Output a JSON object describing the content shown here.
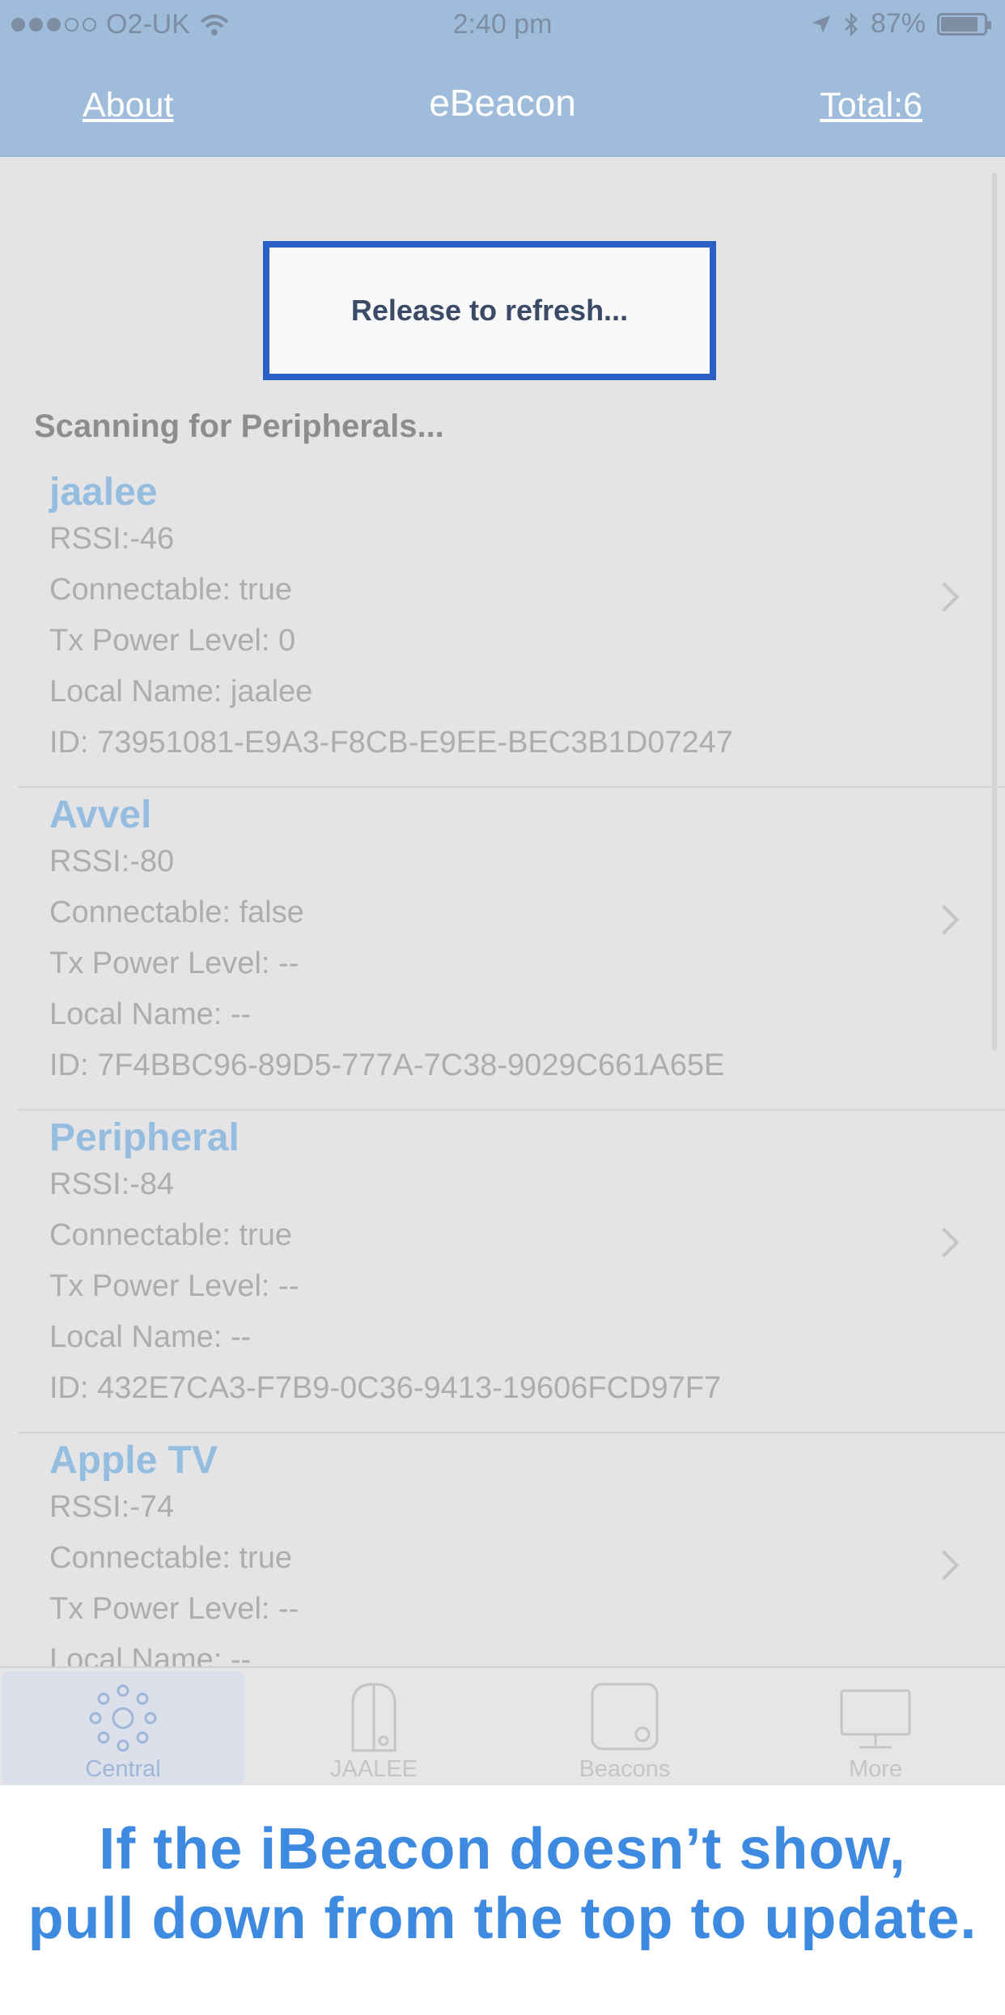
{
  "status_bar": {
    "carrier": "O2-UK",
    "time": "2:40 pm",
    "battery": "87%"
  },
  "nav": {
    "left_link": "About",
    "title": "eBeacon",
    "right_link": "Total:6"
  },
  "refresh": {
    "text": "Release to refresh..."
  },
  "section": {
    "header": "Scanning for Peripherals..."
  },
  "peripherals": [
    {
      "name": "jaalee",
      "rssi": "RSSI:-46",
      "connectable": "Connectable: true",
      "tx": "Tx Power Level:  0",
      "local": "Local Name: jaalee",
      "id": "ID: 73951081-E9A3-F8CB-E9EE-BEC3B1D07247"
    },
    {
      "name": "Avvel",
      "rssi": "RSSI:-80",
      "connectable": "Connectable: false",
      "tx": "Tx Power Level:  --",
      "local": "Local Name: --",
      "id": "ID: 7F4BBC96-89D5-777A-7C38-9029C661A65E"
    },
    {
      "name": "Peripheral",
      "rssi": "RSSI:-84",
      "connectable": "Connectable: true",
      "tx": "Tx Power Level:  --",
      "local": "Local Name: --",
      "id": "ID: 432E7CA3-F7B9-0C36-9413-19606FCD97F7"
    },
    {
      "name": "Apple TV",
      "rssi": "RSSI:-74",
      "connectable": "Connectable: true",
      "tx": "Tx Power Level:  --",
      "local": "Local Name: --",
      "id": ""
    }
  ],
  "tabs": [
    {
      "label": "Central",
      "icon": "central-icon"
    },
    {
      "label": "JAALEE",
      "icon": "jaalee-icon"
    },
    {
      "label": "Beacons",
      "icon": "beacons-icon"
    },
    {
      "label": "More",
      "icon": "monitor-icon"
    }
  ],
  "caption": {
    "line1": "If the iBeacon doesn’t show,",
    "line2": "pull down from the top to update."
  },
  "colors": {
    "navbar": "#9fbdda",
    "accent": "#2a5fc5",
    "caption": "#3d8ae0",
    "name": "#95bddf"
  }
}
